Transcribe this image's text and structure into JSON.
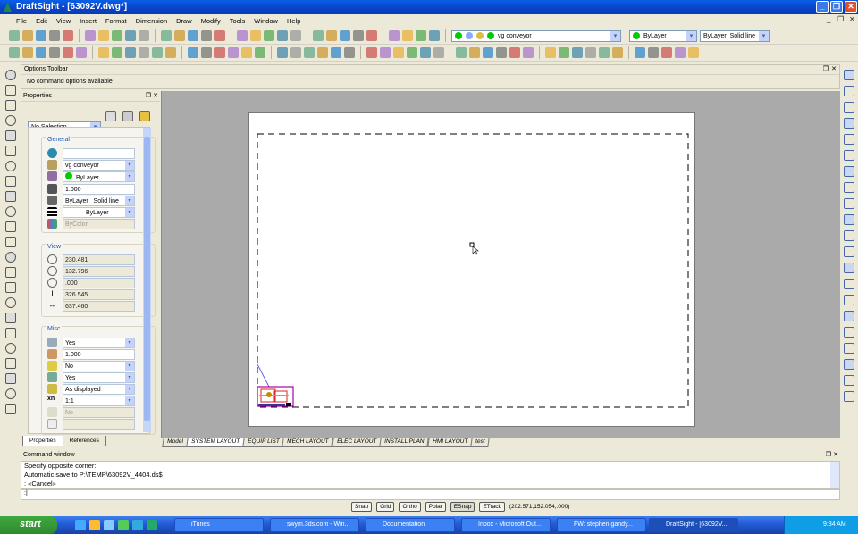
{
  "window": {
    "title": "DraftSight - [63092V.dwg*]"
  },
  "menu": [
    "File",
    "Edit",
    "View",
    "Insert",
    "Format",
    "Dimension",
    "Draw",
    "Modify",
    "Tools",
    "Window",
    "Help"
  ],
  "toolbar1": {
    "icons": [
      "new-icon",
      "open-icon",
      "save-icon",
      "print-icon",
      "print-preview-icon",
      "cut-icon",
      "copy-icon",
      "paste-icon",
      "match-properties-icon",
      "undo-icon",
      "redo-icon",
      "pan-icon",
      "zoom-window-icon",
      "zoom-previous-icon",
      "layer-manager-icon",
      "layer-icon",
      "layer-on-icon",
      "layer-freeze-icon",
      "layer-lock-icon",
      "layer-prev-icon",
      "layer-state-icon",
      "layer-stack-icon",
      "layer-match-icon",
      "layer-check-icon",
      "layer-iso-icon",
      "layer-merge-icon",
      "layer-delete-icon",
      "layer-restore-icon",
      "layer-tools-icon"
    ],
    "layer_combo": "vg conveyor",
    "color_combo": "ByLayer",
    "linestyle_combo": {
      "style": "ByLayer",
      "type": "Solid line"
    }
  },
  "toolbar2": {
    "icons": [
      "zoom-extents-icon",
      "zoom-in-realtime-icon",
      "zoom-out-realtime-icon",
      "zoom-window-icon",
      "zoom-previous-icon",
      "zoom-dynamic-icon",
      "zoom-in-icon",
      "zoom-out-icon",
      "zoom-all-icon",
      "zoom-fit-icon",
      "erase-icon",
      "copy-entity-icon",
      "mirror-icon",
      "offset-icon",
      "pattern-icon",
      "array-icon",
      "move-icon",
      "scale-icon",
      "stretch-icon",
      "fillet-icon",
      "chamfer-icon",
      "trim-icon",
      "extend-icon",
      "break-icon",
      "text-icon",
      "explode-icon",
      "hatch-icon",
      "block-icon",
      "insert-block-icon",
      "bomb-icon",
      "split-icon",
      "join-icon",
      "intersection-icon",
      "perpendicular-icon",
      "endpoint-icon",
      "tangent-icon",
      "line-snap-icon",
      "center-snap-icon",
      "quadrant-snap-icon",
      "node-snap-icon",
      "insertion-snap-icon",
      "midpoint-snap-icon",
      "parallel-snap-icon",
      "nearest-snap-icon",
      "apparent-intersection-icon",
      "extension-snap-icon",
      "snap-settings-icon"
    ]
  },
  "left_tools": [
    "line-icon",
    "infinite-line-icon",
    "circle-icon",
    "rectangle-icon",
    "arc-icon",
    "polyline-icon",
    "circle-center-icon",
    "ellipse-icon",
    "spline-icon",
    "point-icon",
    "freehand-icon",
    "hatch-icon",
    "add-block-icon",
    "region-icon",
    "note-icon",
    "text-icon",
    "attach-icon",
    "xref-icon",
    "document-icon",
    "attribute-icon",
    "layout-icon",
    "sheet-icon",
    "table-icon"
  ],
  "right_tools": [
    "dim-aligned-icon",
    "dim-linear-icon",
    "dim-baseline-icon",
    "dim-continue-icon",
    "dim-ordinate-icon",
    "dim-angular-icon",
    "dim-radius-icon",
    "dim-diameter-icon",
    "dim-arc-icon",
    "dim-center-icon",
    "leader-icon",
    "dim-jog-icon",
    "tolerance-icon",
    "dim-edit-icon",
    "dim-style-icon",
    "dim-override-icon",
    "dim-update-icon",
    "dim-oblique-icon",
    "dim-text-icon",
    "dim-reassociate-icon",
    "smart-dim-icon"
  ],
  "options_toolbar": {
    "title": "Options Toolbar",
    "message": "No command options available"
  },
  "properties": {
    "title": "Properties",
    "selection": "No Selection",
    "general": {
      "label": "General",
      "color": "",
      "layer": "vg conveyor",
      "color_by": "ByLayer",
      "scale": "1.000",
      "linestyle": "ByLayer",
      "linetype": "Solid line",
      "lineweight": "ByLayer",
      "print_style": "ByColor"
    },
    "view": {
      "label": "View",
      "center_x": "230.481",
      "center_y": "132.796",
      "center_z": ".000",
      "height": "326.545",
      "width": "637.460"
    },
    "misc": {
      "label": "Misc",
      "ucs_icon_on": "Yes",
      "scale_factor": "1.000",
      "locked": "No",
      "ucs_per_viewport": "Yes",
      "shade_plot": "As displayed",
      "standard_scale": "1:1",
      "clipped": "No"
    },
    "tabs": [
      "Properties",
      "References"
    ]
  },
  "layout_tabs": [
    "Model",
    "SYSTEM LAYOUT",
    "EQUIP LIST",
    "MECH LAYOUT",
    "ELEC LAYOUT",
    "INSTALL PLAN",
    "HMI LAYOUT",
    "test"
  ],
  "layout_tabs_active": "SYSTEM LAYOUT",
  "command_window": {
    "title": "Command window",
    "lines": [
      "Specify opposite corner:",
      "Automatic save to P:\\TEMP\\63092V_4404.ds$",
      ": «Cancel»"
    ],
    "prompt": ":"
  },
  "status": {
    "buttons": [
      "Snap",
      "Grid",
      "Ortho",
      "Polar",
      "ESnap",
      "ETrack"
    ],
    "coordinates": "(202.571,152.054,.000)"
  },
  "taskbar": {
    "start": "start",
    "tasks": [
      "iTunes",
      "swym.3ds.com - Win...",
      "Documentation",
      "Inbox - Microsoft Out...",
      "FW: stephen.gandy...",
      "DraftSight - [63092V...."
    ],
    "clock": "9:34 AM"
  }
}
